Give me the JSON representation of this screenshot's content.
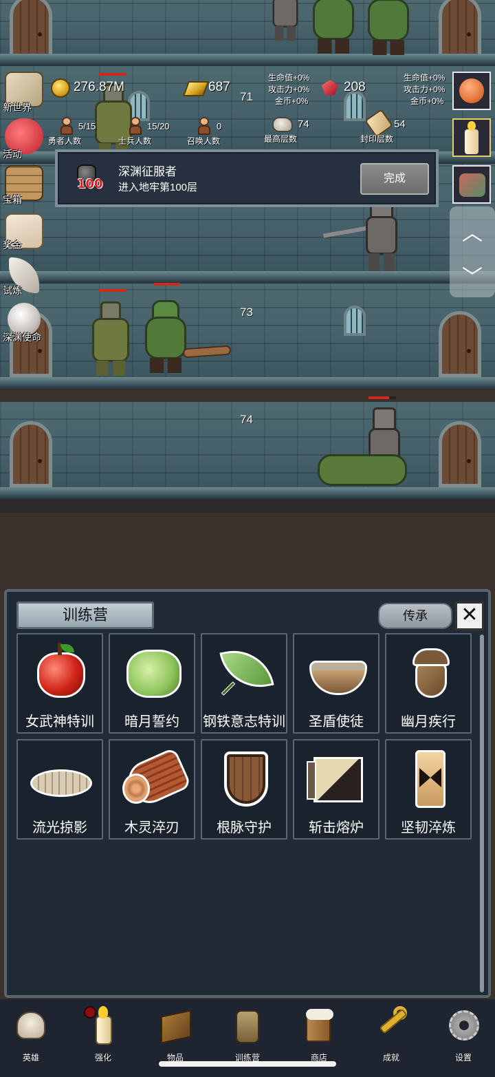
{
  "hud": {
    "gold": "276.87M",
    "gold_bars": "687",
    "gems": "208",
    "buff_left": [
      "生命值+0%",
      "攻击力+0%",
      "金币+0%"
    ],
    "buff_right": [
      "生命值+0%",
      "攻击力+0%",
      "金币+0%"
    ],
    "heroes_count": "5/15",
    "heroes_label": "勇者人数",
    "soldiers_count": "15/20",
    "soldiers_label": "士兵人数",
    "summons_count": "0",
    "summons_label": "召唤人数",
    "max_floor": "74",
    "max_floor_label": "最高层数",
    "sealed_floor": "54",
    "sealed_floor_label": "封印层数"
  },
  "floors": [
    "71",
    "73",
    "74"
  ],
  "side_menu": [
    "新世界",
    "活动",
    "宝箱",
    "奖金",
    "试炼",
    "深渊使命"
  ],
  "achievement": {
    "badge_number": "100",
    "title": "深渊征服者",
    "description": "进入地牢第100层",
    "button": "完成"
  },
  "panel": {
    "title": "训练营",
    "inherit_button": "传承",
    "close_icon": "close-icon",
    "items": [
      {
        "name": "女武神特训",
        "icon": "apple-icon"
      },
      {
        "name": "暗月誓约",
        "icon": "cabbage-icon"
      },
      {
        "name": "钢铁意志特训",
        "icon": "leaf-icon"
      },
      {
        "name": "圣盾使徒",
        "icon": "bowl-icon"
      },
      {
        "name": "幽月疾行",
        "icon": "acorn-icon"
      },
      {
        "name": "流光掠影",
        "icon": "fossil-icon"
      },
      {
        "name": "木灵淬刃",
        "icon": "log-icon"
      },
      {
        "name": "根脉守护",
        "icon": "shield-icon"
      },
      {
        "name": "斩击熔炉",
        "icon": "cube-icon"
      },
      {
        "name": "坚韧淬炼",
        "icon": "plate-icon"
      }
    ]
  },
  "nav": [
    "英雄",
    "强化",
    "物品",
    "训练营",
    "商店",
    "成就",
    "设置"
  ],
  "colors": {
    "panel_bg": "#222a36",
    "hp_bar": "#d0281e",
    "badge_red": "#e32020"
  }
}
